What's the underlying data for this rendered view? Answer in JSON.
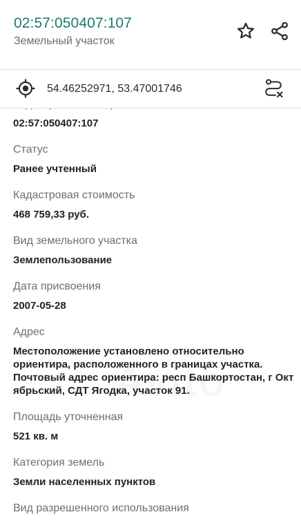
{
  "header": {
    "title": "02:57:050407:107",
    "subtitle": "Земельный участок",
    "icons": {
      "favorite": "star-outline-icon",
      "share": "share-icon"
    }
  },
  "location": {
    "coordinates": "54.46252971, 53.47001746",
    "icons": {
      "locate": "crosshair-target-icon",
      "route": "route-clear-icon"
    }
  },
  "details": [
    {
      "label": "Кадастровый номер",
      "value": "02:57:050407:107"
    },
    {
      "label": "Статус",
      "value": "Ранее учтенный"
    },
    {
      "label": "Кадастровая стоимость",
      "value": "468 759,33 руб."
    },
    {
      "label": "Вид земельного участка",
      "value": "Землепользование"
    },
    {
      "label": "Дата присвоения",
      "value": "2007-05-28"
    },
    {
      "label": "Адрес",
      "value": "Местоположение установлено относительно\nориентира, расположенного в границах участка.\nПочтовый адрес ориентира: респ Башкортостан, г Окт\nябрьский, СДТ Ягодка, участок 91."
    },
    {
      "label": "Площадь уточненная",
      "value": "521 кв. м"
    },
    {
      "label": "Категория земель",
      "value": "Земли населенных пунктов"
    },
    {
      "label": "Вид разрешенного использования",
      "value": ""
    }
  ],
  "watermark": "Avito",
  "colors": {
    "accent": "#1f7a6b",
    "label": "#6e6e6e",
    "value": "#222222",
    "divider": "#e2e2e2"
  }
}
